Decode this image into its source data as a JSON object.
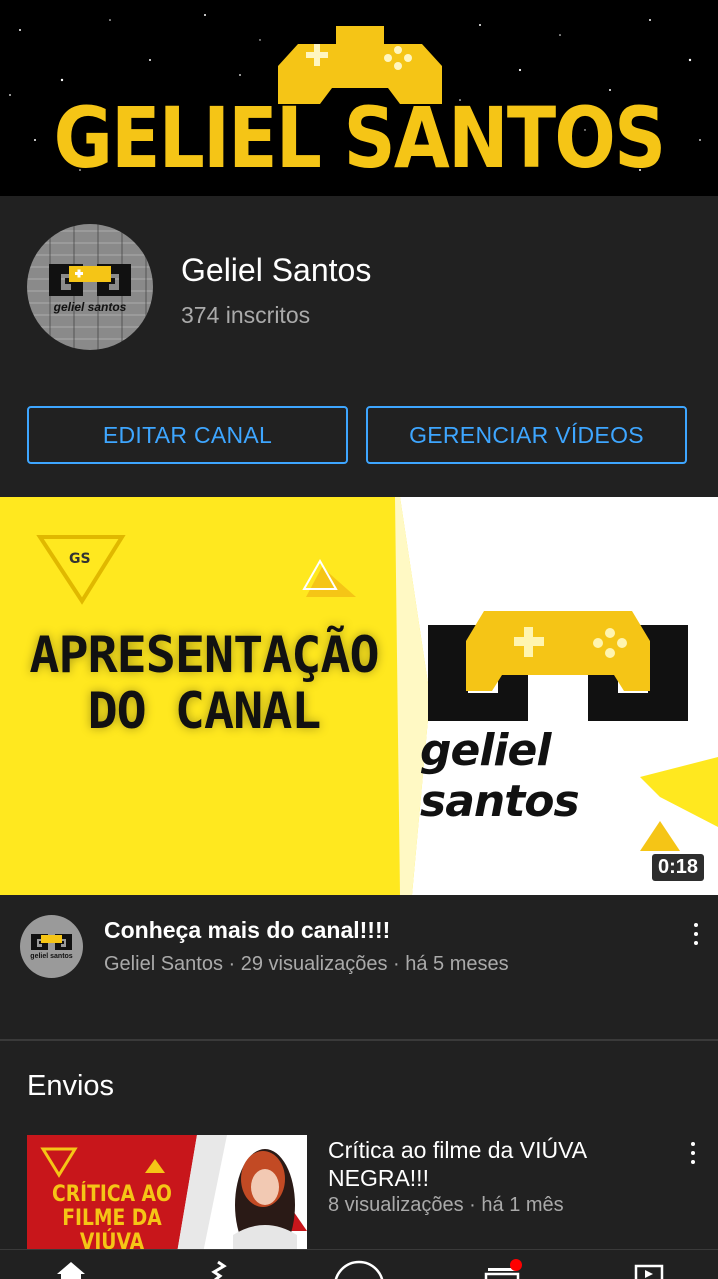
{
  "banner": {
    "title": "GELIEL SANTOS"
  },
  "channel": {
    "name": "Geliel Santos",
    "subscribers": "374 inscritos",
    "avatar_text": "geliel santos",
    "edit_button": "EDITAR CANAL",
    "manage_button": "GERENCIAR VÍDEOS"
  },
  "featured": {
    "thumb_title_line1": "APRESENTAÇÃO",
    "thumb_title_line2": "DO CANAL",
    "thumb_logo_text": "geliel santos",
    "duration": "0:18",
    "title": "Conheça mais do canal!!!!",
    "info": "Geliel Santos · 29 visualizações · há 5 meses",
    "avatar_text": "geliel santos"
  },
  "uploads": {
    "section_title": "Envios",
    "items": [
      {
        "title": "Crítica ao filme da VIÚVA NEGRA!!!",
        "info": "8 visualizações · há 1 mês",
        "thumb_text_line1": "CRÍTICA AO",
        "thumb_text_line2": "FILME DA",
        "thumb_text_line3": "VIÚVA NEGRA"
      }
    ]
  },
  "nav": {
    "items": [
      "home-icon",
      "shorts-icon",
      "create-icon",
      "subscriptions-icon",
      "library-icon"
    ],
    "notification_color": "#ff0000"
  },
  "colors": {
    "accent": "#3ea6ff",
    "brand_yellow": "#f5c516",
    "background": "#212121"
  }
}
